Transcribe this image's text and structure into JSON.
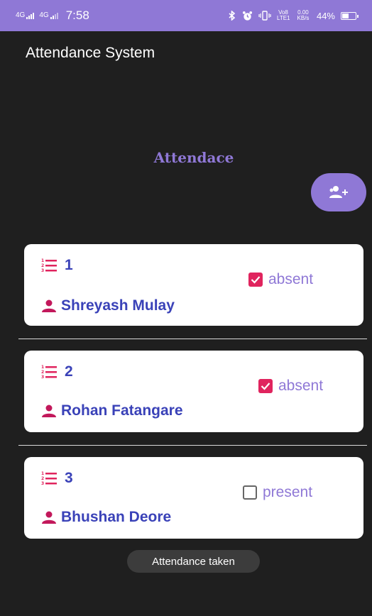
{
  "status_bar": {
    "network_1": "4G",
    "network_2": "4G",
    "time": "7:58",
    "volte": "Vo8 LTE1",
    "speed": "0.00 KB/s",
    "battery": "44%"
  },
  "app_title": "Attendance System",
  "heading": "Attendace",
  "add_button_icon": "add-person-icon",
  "students": [
    {
      "roll": "1",
      "name": "Shreyash Mulay",
      "status_label": "absent",
      "checked": true
    },
    {
      "roll": "2",
      "name": "Rohan Fatangare",
      "status_label": "absent",
      "checked": true
    },
    {
      "roll": "3",
      "name": "Bhushan Deore",
      "status_label": "present",
      "checked": false
    }
  ],
  "toast": "Attendance taken",
  "colors": {
    "accent": "#8f78d6",
    "name_blue": "#3a42b8",
    "checkbox_pink": "#e0245e",
    "list_icon_red": "#e0245e",
    "person_icon": "#c2185b",
    "background": "#1f1f1f"
  }
}
